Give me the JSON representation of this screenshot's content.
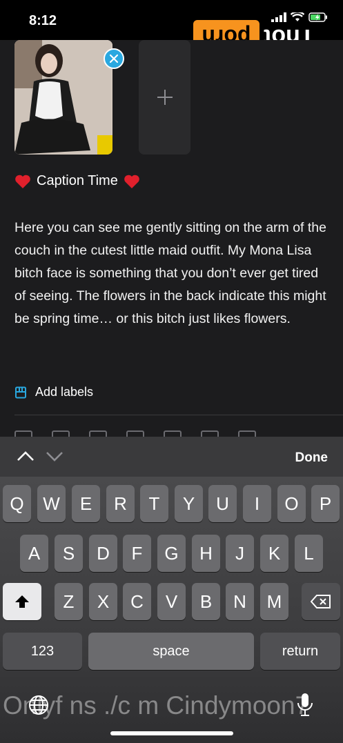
{
  "status": {
    "time": "8:12"
  },
  "watermark": {
    "left": "porn",
    "right": "Thot"
  },
  "caption": {
    "title": "Caption Time",
    "body": "Here you can see me gently sitting on the arm of the couch in the cutest little maid outfit. My Mona Lisa bitch face is something that you don’t ever get tired of seeing. The flowers in the back indicate this might be spring time… or this bitch just likes flowers."
  },
  "labels": {
    "add_label": "Add labels"
  },
  "accessory": {
    "done_label": "Done"
  },
  "keyboard": {
    "row1": [
      "Q",
      "W",
      "E",
      "R",
      "T",
      "Y",
      "U",
      "I",
      "O",
      "P"
    ],
    "row2": [
      "A",
      "S",
      "D",
      "F",
      "G",
      "H",
      "J",
      "K",
      "L"
    ],
    "row3": [
      "Z",
      "X",
      "C",
      "V",
      "B",
      "N",
      "M"
    ],
    "numbers_label": "123",
    "space_label": "space",
    "return_label": "return"
  },
  "overlay": {
    "text": "Onlyf ns ./c m Cindymoon7"
  },
  "colors": {
    "accent": "#29a8e0",
    "heart": "#e0202c",
    "watermark_orange": "#f7931e"
  }
}
